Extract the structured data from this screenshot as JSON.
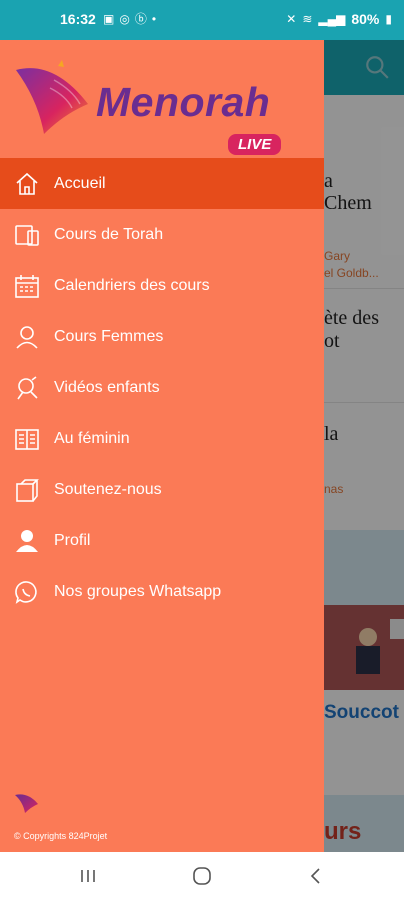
{
  "status": {
    "time": "16:32",
    "battery": "80%"
  },
  "background": {
    "text1": "a",
    "text2": "Chem",
    "small1": "Gary",
    "small2": "el Goldb...",
    "text3": "ète des",
    "text4": "ot",
    "text5": "la",
    "small3": "nas",
    "link": "Souccot",
    "bottom_text": "urs"
  },
  "drawer": {
    "logo_title": "Menorah",
    "logo_badge": "LIVE",
    "menu": [
      {
        "label": "Accueil",
        "icon": "home-icon",
        "active": true
      },
      {
        "label": "Cours de Torah",
        "icon": "devices-icon"
      },
      {
        "label": "Calendriers des cours",
        "icon": "calendar-icon"
      },
      {
        "label": "Cours Femmes",
        "icon": "woman-icon"
      },
      {
        "label": "Vidéos enfants",
        "icon": "child-icon"
      },
      {
        "label": "Au féminin",
        "icon": "magazine-icon"
      },
      {
        "label": "Soutenez-nous",
        "icon": "donate-icon"
      },
      {
        "label": "Profil",
        "icon": "profile-icon"
      },
      {
        "label": "Nos groupes Whatsapp",
        "icon": "whatsapp-icon"
      }
    ],
    "copyright": "© Copyrights 824Projet"
  },
  "colors": {
    "drawer_bg": "#fb7a56",
    "active_item": "#e64c1b",
    "status_bar": "#1aa3b1",
    "logo_purple": "#6a2d90",
    "live_badge": "#d8245f"
  }
}
